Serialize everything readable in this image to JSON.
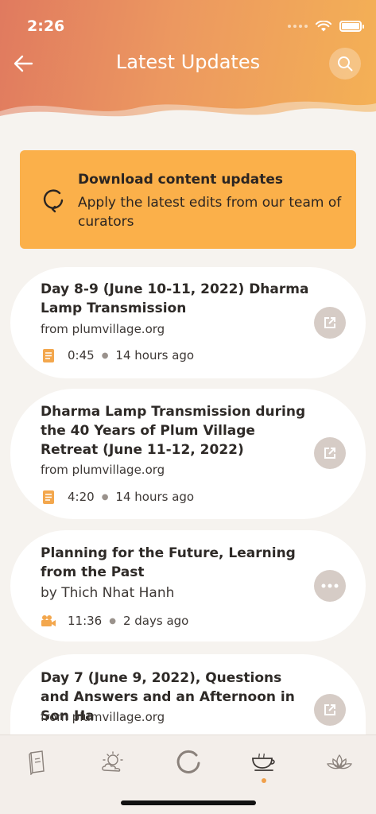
{
  "status_bar": {
    "time": "2:26"
  },
  "header": {
    "title": "Latest Updates"
  },
  "banner": {
    "title": "Download content updates",
    "description": "Apply the latest edits from our team of curators"
  },
  "items": [
    {
      "title": "Day 8-9 (June 10-11, 2022) Dharma Lamp Transmission",
      "source": "from plumvillage.org",
      "media_icon": "document-icon",
      "duration": "0:45",
      "age": "14 hours ago",
      "action_icon": "external-link-icon"
    },
    {
      "title": "Dharma Lamp Transmission during the 40 Years of Plum Village Retreat (June 11-12, 2022)",
      "source": "from plumvillage.org",
      "media_icon": "document-icon",
      "duration": "4:20",
      "age": "14 hours ago",
      "action_icon": "external-link-icon"
    },
    {
      "title": "Planning for the Future, Learning from the Past",
      "source": "by Thich Nhat Hanh",
      "media_icon": "video-camera-icon",
      "duration": "11:36",
      "age": "2 days ago",
      "action_icon": "more-options-icon"
    },
    {
      "title": "Day 7 (June 9, 2022), Questions and Answers and an Afternoon in Son Ha",
      "source": "from plumvillage.org",
      "action_icon": "external-link-icon"
    }
  ],
  "tabs": [
    {
      "icon": "book-icon"
    },
    {
      "icon": "sun-cloud-icon"
    },
    {
      "icon": "enso-circle-icon"
    },
    {
      "icon": "tea-cup-icon",
      "active": true
    },
    {
      "icon": "lotus-icon"
    }
  ],
  "colors": {
    "header_start": "#e07a5f",
    "header_end": "#f4b155",
    "banner": "#fbb04a",
    "background": "#f6f3ef",
    "accent": "#f0a04b",
    "action_button": "#d6ccc6"
  }
}
